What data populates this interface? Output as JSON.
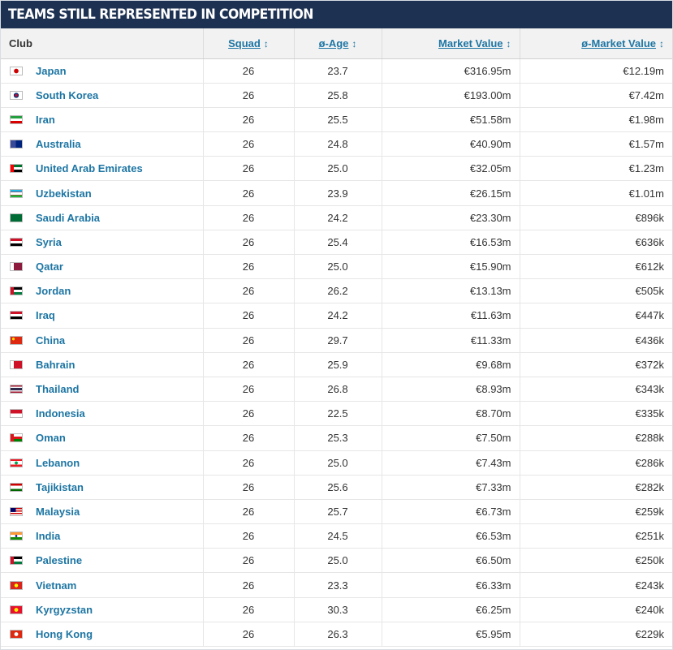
{
  "header": {
    "title": "TEAMS STILL REPRESENTED IN COMPETITION"
  },
  "columns": {
    "club": "Club",
    "squad": "Squad",
    "age": "ø-Age",
    "market_value": "Market Value",
    "avg_market_value": "ø-Market Value",
    "sort_icon": "↕"
  },
  "rows": [
    {
      "flag": "japan",
      "club": "Japan",
      "squad": "26",
      "age": "23.7",
      "market_value": "€316.95m",
      "avg_market_value": "€12.19m"
    },
    {
      "flag": "korea",
      "club": "South Korea",
      "squad": "26",
      "age": "25.8",
      "market_value": "€193.00m",
      "avg_market_value": "€7.42m"
    },
    {
      "flag": "iran",
      "club": "Iran",
      "squad": "26",
      "age": "25.5",
      "market_value": "€51.58m",
      "avg_market_value": "€1.98m"
    },
    {
      "flag": "australia",
      "club": "Australia",
      "squad": "26",
      "age": "24.8",
      "market_value": "€40.90m",
      "avg_market_value": "€1.57m"
    },
    {
      "flag": "uae",
      "club": "United Arab Emirates",
      "squad": "26",
      "age": "25.0",
      "market_value": "€32.05m",
      "avg_market_value": "€1.23m"
    },
    {
      "flag": "uzbekistan",
      "club": "Uzbekistan",
      "squad": "26",
      "age": "23.9",
      "market_value": "€26.15m",
      "avg_market_value": "€1.01m"
    },
    {
      "flag": "saudi",
      "club": "Saudi Arabia",
      "squad": "26",
      "age": "24.2",
      "market_value": "€23.30m",
      "avg_market_value": "€896k"
    },
    {
      "flag": "syria",
      "club": "Syria",
      "squad": "26",
      "age": "25.4",
      "market_value": "€16.53m",
      "avg_market_value": "€636k"
    },
    {
      "flag": "qatar",
      "club": "Qatar",
      "squad": "26",
      "age": "25.0",
      "market_value": "€15.90m",
      "avg_market_value": "€612k"
    },
    {
      "flag": "jordan",
      "club": "Jordan",
      "squad": "26",
      "age": "26.2",
      "market_value": "€13.13m",
      "avg_market_value": "€505k"
    },
    {
      "flag": "iraq",
      "club": "Iraq",
      "squad": "26",
      "age": "24.2",
      "market_value": "€11.63m",
      "avg_market_value": "€447k"
    },
    {
      "flag": "china",
      "club": "China",
      "squad": "26",
      "age": "29.7",
      "market_value": "€11.33m",
      "avg_market_value": "€436k"
    },
    {
      "flag": "bahrain",
      "club": "Bahrain",
      "squad": "26",
      "age": "25.9",
      "market_value": "€9.68m",
      "avg_market_value": "€372k"
    },
    {
      "flag": "thailand",
      "club": "Thailand",
      "squad": "26",
      "age": "26.8",
      "market_value": "€8.93m",
      "avg_market_value": "€343k"
    },
    {
      "flag": "indonesia",
      "club": "Indonesia",
      "squad": "26",
      "age": "22.5",
      "market_value": "€8.70m",
      "avg_market_value": "€335k"
    },
    {
      "flag": "oman",
      "club": "Oman",
      "squad": "26",
      "age": "25.3",
      "market_value": "€7.50m",
      "avg_market_value": "€288k"
    },
    {
      "flag": "lebanon",
      "club": "Lebanon",
      "squad": "26",
      "age": "25.0",
      "market_value": "€7.43m",
      "avg_market_value": "€286k"
    },
    {
      "flag": "tajikistan",
      "club": "Tajikistan",
      "squad": "26",
      "age": "25.6",
      "market_value": "€7.33m",
      "avg_market_value": "€282k"
    },
    {
      "flag": "malaysia",
      "club": "Malaysia",
      "squad": "26",
      "age": "25.7",
      "market_value": "€6.73m",
      "avg_market_value": "€259k"
    },
    {
      "flag": "india",
      "club": "India",
      "squad": "26",
      "age": "24.5",
      "market_value": "€6.53m",
      "avg_market_value": "€251k"
    },
    {
      "flag": "palestine",
      "club": "Palestine",
      "squad": "26",
      "age": "25.0",
      "market_value": "€6.50m",
      "avg_market_value": "€250k"
    },
    {
      "flag": "vietnam",
      "club": "Vietnam",
      "squad": "26",
      "age": "23.3",
      "market_value": "€6.33m",
      "avg_market_value": "€243k"
    },
    {
      "flag": "kyrgyzstan",
      "club": "Kyrgyzstan",
      "squad": "26",
      "age": "30.3",
      "market_value": "€6.25m",
      "avg_market_value": "€240k"
    },
    {
      "flag": "hongkong",
      "club": "Hong Kong",
      "squad": "26",
      "age": "26.3",
      "market_value": "€5.95m",
      "avg_market_value": "€229k"
    }
  ]
}
